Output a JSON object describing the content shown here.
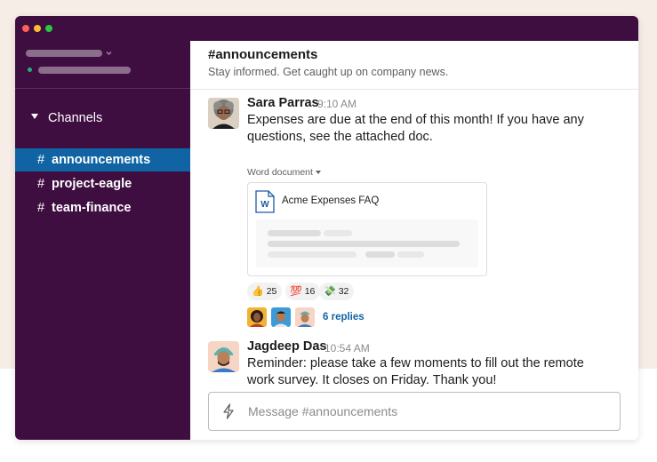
{
  "colors": {
    "sidebar_bg": "#3f0e40",
    "active_channel_bg": "#1164a3",
    "link": "#1264a3",
    "page_bg": "#f5ede6"
  },
  "window_controls": [
    "close",
    "minimize",
    "maximize"
  ],
  "sidebar": {
    "channels_header": "Channels",
    "channels": [
      {
        "hash": "#",
        "name": "announcements",
        "active": true
      },
      {
        "hash": "#",
        "name": "project-eagle",
        "active": false
      },
      {
        "hash": "#",
        "name": "team-finance",
        "active": false
      }
    ]
  },
  "channel": {
    "title": "#announcements",
    "topic": "Stay informed. Get caught up on company news."
  },
  "messages": [
    {
      "author": "Sara Parras",
      "time": "9:10 AM",
      "text": "Expenses are due at the end of this month! If you have any questions, see the attached doc.",
      "attachment": {
        "label": "Word document",
        "icon": "word-doc-icon",
        "icon_letter": "W",
        "title": "Acme Expenses FAQ"
      },
      "reactions": [
        {
          "emoji": "👍",
          "icon": "thumbs-up-icon",
          "count": "25"
        },
        {
          "emoji": "💯",
          "icon": "hundred-points-icon",
          "count": "16"
        },
        {
          "emoji": "💸",
          "icon": "money-with-wings-icon",
          "count": "32"
        }
      ],
      "replies": "6 replies"
    },
    {
      "author": "Jagdeep Das",
      "time": "10:54 AM",
      "text": "Reminder: please take a few moments to fill out the remote work survey. It closes on Friday. Thank you!"
    }
  ],
  "composer": {
    "placeholder": "Message #announcements",
    "icon": "lightning-bolt-icon"
  }
}
